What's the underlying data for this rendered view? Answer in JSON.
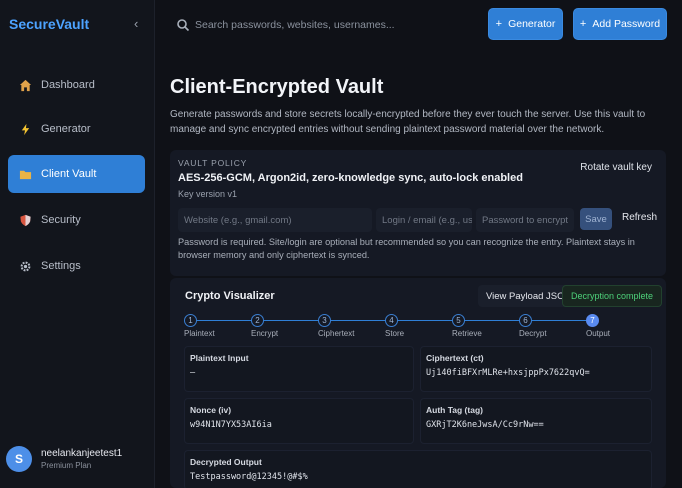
{
  "sidebar": {
    "brand": "SecureVault",
    "collapse_glyph": "‹",
    "items": [
      {
        "label": "Dashboard",
        "icon": "home-icon"
      },
      {
        "label": "Generator",
        "icon": "lightning-icon"
      },
      {
        "label": "Client Vault",
        "icon": "folder-icon",
        "active": true
      },
      {
        "label": "Security",
        "icon": "shield-icon"
      },
      {
        "label": "Settings",
        "icon": "gear-icon"
      }
    ],
    "user": {
      "initial": "S",
      "name": "neelankanjeetest1",
      "plan": "Premium Plan"
    }
  },
  "topbar": {
    "search_placeholder": "Search passwords, websites, usernames...",
    "generator_label": "Generator",
    "add_password_label": "Add Password"
  },
  "main": {
    "title": "Client-Encrypted Vault",
    "description": "Generate passwords and store secrets locally-encrypted before they ever touch the server. Use this vault to manage and sync encrypted entries without sending plaintext password material over the network.",
    "policy": {
      "label": "VAULT POLICY",
      "value": "AES-256-GCM, Argon2id, zero-knowledge sync, auto-lock enabled",
      "version": "Key version v1",
      "rotate_label": "Rotate vault key",
      "website_placeholder": "Website (e.g., gmail.com)",
      "login_placeholder": "Login / email (e.g., use",
      "password_placeholder": "Password to encrypt",
      "save_label": "Save",
      "refresh_label": "Refresh",
      "note": "Password is required. Site/login are optional but recommended so you can recognize the entry. Plaintext stays in browser memory and only ciphertext is synced."
    },
    "visualizer": {
      "title": "Crypto Visualizer",
      "view_json_label": "View Payload JSON",
      "status": "Decryption complete",
      "steps": [
        {
          "num": "1",
          "label": "Plaintext"
        },
        {
          "num": "2",
          "label": "Encrypt"
        },
        {
          "num": "3",
          "label": "Ciphertext"
        },
        {
          "num": "4",
          "label": "Store"
        },
        {
          "num": "5",
          "label": "Retrieve"
        },
        {
          "num": "6",
          "label": "Decrypt"
        },
        {
          "num": "7",
          "label": "Output",
          "active": true
        }
      ],
      "plaintext_input": {
        "label": "Plaintext Input",
        "value": "–"
      },
      "ciphertext": {
        "label": "Ciphertext (ct)",
        "value": "Uj140fiBFXrMLRe+hxsjppPx7622qvQ="
      },
      "nonce": {
        "label": "Nonce (iv)",
        "value": "w94N1N7YX53AI6ia"
      },
      "auth_tag": {
        "label": "Auth Tag (tag)",
        "value": "GXRjT2K6neJwsA/Cc9rNw=="
      },
      "decrypted_output": {
        "label": "Decrypted Output",
        "value": "Testpassword@12345!@#$%"
      }
    }
  },
  "colors": {
    "accent": "#2f7fd6",
    "success": "#4ed17a",
    "background": "#0f1117",
    "brand": "#4da3ff"
  }
}
